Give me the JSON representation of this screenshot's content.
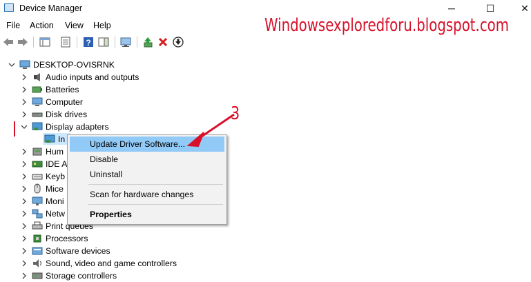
{
  "window": {
    "title": "Device Manager",
    "minimize": "─",
    "maximize": "☐",
    "close": "✕"
  },
  "menu": [
    "File",
    "Action",
    "View",
    "Help"
  ],
  "watermark": "Windowsexploredforu.blogspot.com",
  "tree": {
    "root": "DESKTOP-OVISRNK",
    "items": [
      {
        "label": "Audio inputs and outputs",
        "icon": "speaker-icon"
      },
      {
        "label": "Batteries",
        "icon": "battery-icon"
      },
      {
        "label": "Computer",
        "icon": "computer-icon"
      },
      {
        "label": "Disk drives",
        "icon": "disk-drive-icon"
      },
      {
        "label": "Display adapters",
        "icon": "display-adapter-icon",
        "expanded": true
      },
      {
        "label": "In",
        "icon": "display-adapter-icon",
        "child": true,
        "selected": true
      },
      {
        "label": "Hum",
        "icon": "hid-icon"
      },
      {
        "label": "IDE A",
        "icon": "ide-icon"
      },
      {
        "label": "Keyb",
        "icon": "keyboard-icon"
      },
      {
        "label": "Mice",
        "icon": "mouse-icon"
      },
      {
        "label": "Moni",
        "icon": "monitor-icon"
      },
      {
        "label": "Netw",
        "icon": "network-icon"
      },
      {
        "label": "Print queues",
        "icon": "printer-icon"
      },
      {
        "label": "Processors",
        "icon": "processor-icon"
      },
      {
        "label": "Software devices",
        "icon": "software-device-icon"
      },
      {
        "label": "Sound, video and game controllers",
        "icon": "sound-icon"
      },
      {
        "label": "Storage controllers",
        "icon": "storage-icon"
      }
    ]
  },
  "context_menu": {
    "update": "Update Driver Software...",
    "disable": "Disable",
    "uninstall": "Uninstall",
    "scan": "Scan for hardware changes",
    "properties": "Properties"
  },
  "annotations": {
    "step1": "1",
    "step3": "3"
  },
  "colors": {
    "accent": "#d8102a",
    "highlight": "#91c9f7",
    "selection": "#cce8ff"
  }
}
